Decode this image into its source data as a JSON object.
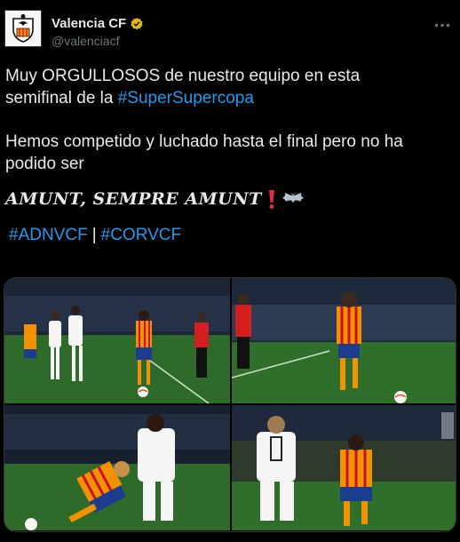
{
  "author": {
    "name": "Valencia CF",
    "handle": "@valenciacf",
    "verified_icon": "verified-badge-icon",
    "avatar_icon": "valencia-crest-icon"
  },
  "tweet": {
    "line1_text": "Muy ORGULLOSOS de nuestro equipo en esta",
    "line2_text": "semifinal de la ",
    "line2_hashtag": "#SuperSupercopa",
    "paragraph2": "Hemos competido y luchado hasta el final pero no ha podido ser",
    "motto": "AMUNT, SEMPRE AMUNT",
    "motto_emojis": [
      "heavy-exclamation-mark-icon",
      "bat-icon"
    ],
    "hashtag_a": "#ADNVCF",
    "separator": "|",
    "hashtag_b": "#CORVCF"
  },
  "media": {
    "photos": [
      {
        "name": "photo-1",
        "icon": "football-match-photo"
      },
      {
        "name": "photo-2",
        "icon": "football-match-photo"
      },
      {
        "name": "photo-3",
        "icon": "football-match-photo"
      },
      {
        "name": "photo-4",
        "icon": "football-match-photo"
      }
    ]
  },
  "colors": {
    "background": "#000000",
    "text": "#e7e9ea",
    "secondary": "#71767b",
    "link": "#1d9bf0",
    "border": "#2f3336",
    "valencia_orange": "#f39200",
    "pitch_green": "#2e6b2a"
  }
}
